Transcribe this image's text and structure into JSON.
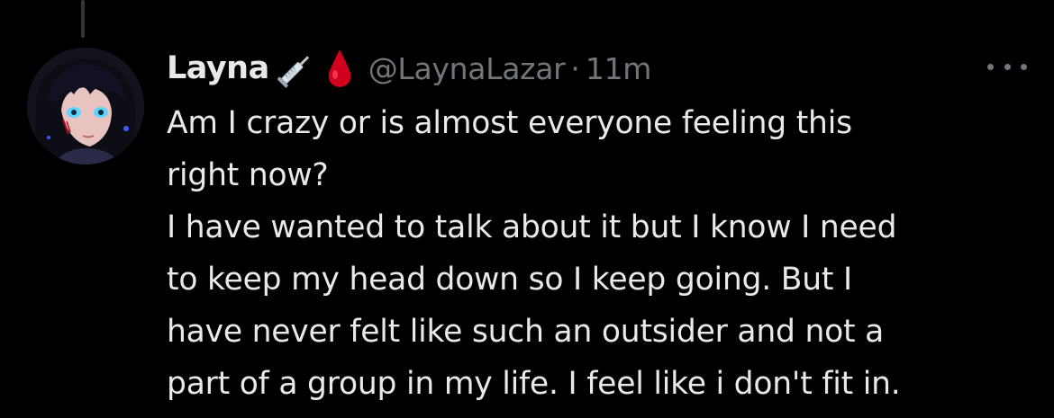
{
  "tweet": {
    "display_name": "Layna",
    "name_emojis": [
      "syringe-emoji",
      "blood-drop-emoji"
    ],
    "handle": "@LaynaLazar",
    "separator": "·",
    "time": "11m",
    "more_icon": "more-horizontal-icon",
    "lines": [
      "Am I crazy or is almost everyone feeling this",
      "right now?",
      "I have wanted to talk about it but I know I need",
      "to keep my head down so I keep going. But I",
      "have never felt like such an outsider and not a",
      "part of a group in my life. I feel like i don't fit in."
    ]
  },
  "colors": {
    "background": "#000000",
    "primary_text": "#e7e9ea",
    "secondary_text": "#71767b",
    "thread_line": "#333639",
    "blood_drop": "#d1001c"
  }
}
